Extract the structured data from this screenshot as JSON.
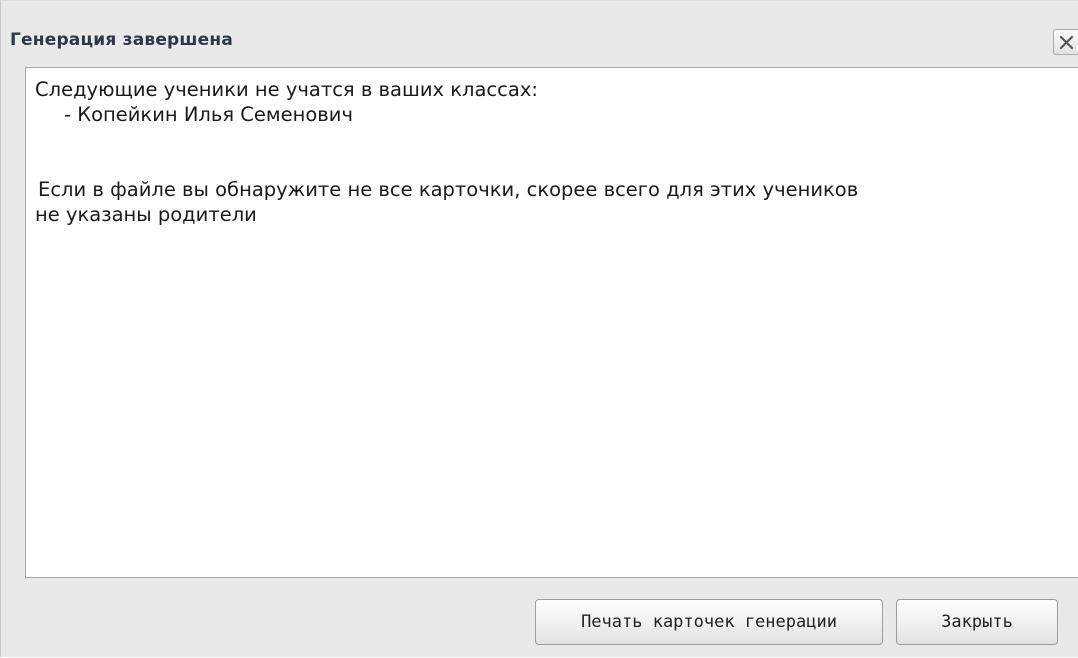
{
  "window": {
    "title": "Генерация завершена",
    "close_icon": "close-x-icon"
  },
  "message": {
    "line1": "Следующие ученики не учатся в ваших классах:",
    "line2": "- Копейкин Илья Семенович",
    "line3": "Если в файле вы обнаружите не все карточки, скорее всего для этих учеников",
    "line4": "не указаны родители"
  },
  "buttons": {
    "print_label": "Печать карточек генерации",
    "close_label": "Закрыть"
  },
  "colors": {
    "dialog_bg": "#e9e9e9",
    "title_text": "#2b3a4a",
    "body_bg": "#ffffff"
  }
}
